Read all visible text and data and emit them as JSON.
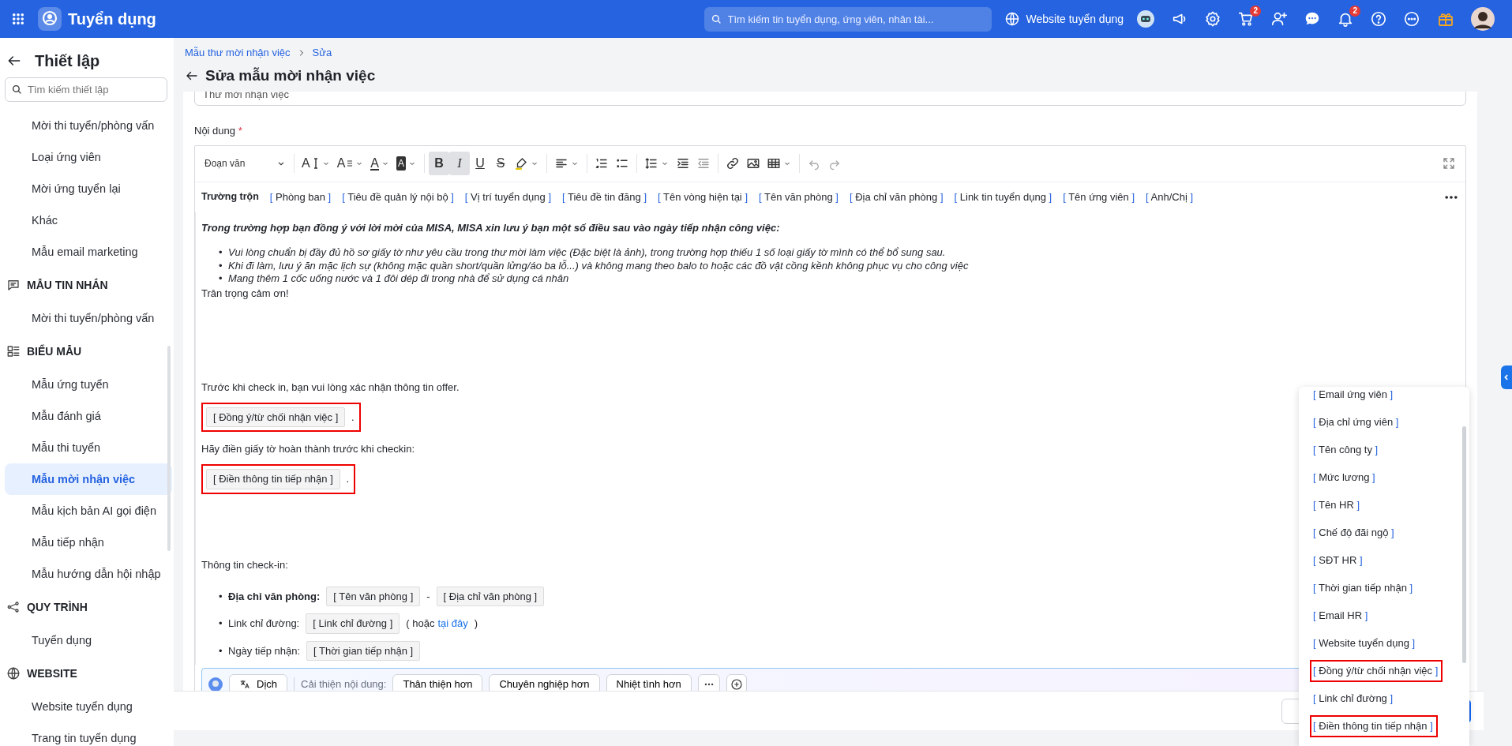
{
  "topbar": {
    "app_title": "Tuyển dụng",
    "search_placeholder": "Tìm kiếm tin tuyển dụng, ứng viên, nhân tài...",
    "website_link": "Website tuyển dụng",
    "cart_badge": "2",
    "bell_badge": "2"
  },
  "sidebar": {
    "title": "Thiết lập",
    "search_placeholder": "Tìm kiếm thiết lập",
    "groups": [
      {
        "items": [
          {
            "label": "Mời thi tuyển/phòng vấn",
            "selected": false
          },
          {
            "label": "Loại ứng viên",
            "selected": false
          },
          {
            "label": "Mời ứng tuyển lại",
            "selected": false
          },
          {
            "label": "Khác",
            "selected": false
          },
          {
            "label": "Mẫu email marketing",
            "selected": false
          }
        ]
      },
      {
        "heading": "MẪU TIN NHẮN",
        "kind": "message",
        "items": [
          {
            "label": "Mời thi tuyển/phòng vấn",
            "selected": false
          }
        ]
      },
      {
        "heading": "BIỂU MẪU",
        "kind": "form",
        "items": [
          {
            "label": "Mẫu ứng tuyển",
            "selected": false
          },
          {
            "label": "Mẫu đánh giá",
            "selected": false
          },
          {
            "label": "Mẫu thi tuyển",
            "selected": false
          },
          {
            "label": "Mẫu mời nhận việc",
            "selected": true
          },
          {
            "label": "Mẫu kịch bản AI gọi điện",
            "selected": false
          },
          {
            "label": "Mẫu tiếp nhận",
            "selected": false
          },
          {
            "label": "Mẫu hướng dẫn hội nhập",
            "selected": false
          }
        ]
      },
      {
        "heading": "QUY TRÌNH",
        "kind": "process",
        "items": [
          {
            "label": "Tuyển dụng",
            "selected": false
          }
        ]
      },
      {
        "heading": "WEBSITE",
        "kind": "web",
        "items": [
          {
            "label": "Website tuyển dụng",
            "selected": false
          },
          {
            "label": "Trang tin tuyển dụng",
            "selected": false
          }
        ]
      }
    ]
  },
  "breadcrumb": [
    "Mẫu thư mời nhận việc",
    "Sửa"
  ],
  "page_title": "Sửa mẫu mời nhận việc",
  "name_field": {
    "value": "Thư mời nhận việc"
  },
  "content_label": {
    "text": "Nội dung",
    "required_mark": "*"
  },
  "toolbar": {
    "block_format": "Đoạn văn",
    "text_tools": [
      {
        "kind": "size",
        "glyph": "A"
      },
      {
        "kind": "style",
        "glyph": "A"
      },
      {
        "kind": "color",
        "glyph": "A"
      },
      {
        "kind": "background",
        "glyph": "A"
      }
    ],
    "format_tools": [
      {
        "kind": "bold",
        "glyph": "B",
        "active": true
      },
      {
        "kind": "italic",
        "glyph": "I",
        "active": true
      },
      {
        "kind": "underline",
        "glyph": "U",
        "active": false
      },
      {
        "kind": "strike",
        "glyph": "S",
        "active": false
      }
    ]
  },
  "merge_fields": {
    "label": "Trường trộn",
    "fields": [
      "[ Phòng ban ]",
      "[ Tiêu đề quản lý nội bộ ]",
      "[ Vị trí tuyển dụng ]",
      "[ Tiêu đề tin đăng ]",
      "[ Tên vòng hiện tại ]",
      "[ Tên văn phòng ]",
      "[ Địa chỉ văn phòng ]",
      "[ Link tin tuyển dụng ]",
      "[ Tên ứng viên ]",
      "[ Anh/Chị ]"
    ]
  },
  "content": [
    {
      "kind": "lead",
      "text": "Trong trường hợp bạn đồng ý với lời mời của MISA, MISA xin lưu ý bạn một số điều sau vào ngày tiếp nhận công việc:"
    },
    {
      "kind": "italic_list",
      "items": [
        {
          "bullet": "•",
          "text": "Vui lòng chuẩn bị đầy đủ hồ sơ giấy tờ như yêu cầu trong thư mời làm việc (Đặc biệt là ảnh), trong trường hợp thiếu 1 số loại giấy tờ mình có thể bổ sung sau."
        },
        {
          "bullet": "•",
          "text": "Khi đi làm, lưu ý ăn mặc lịch sự (không mặc quần short/quần lửng/áo ba lỗ...) và không mang theo balo to hoặc các đồ vật cồng kềnh không phục vụ cho công việc"
        },
        {
          "bullet": "•",
          "text": "Mang thêm 1 cốc uống nước và 1 đôi dép đi trong nhà để sử dụng cá nhân"
        }
      ]
    },
    {
      "kind": "paragraph",
      "text": "Trân trọng cảm ơn!"
    },
    {
      "kind": "large_gap"
    },
    {
      "kind": "paragraph",
      "text": "Trước khi check in, bạn vui lòng xác nhận thông tin offer."
    },
    {
      "kind": "token_line",
      "token": "[ Đồng ý/từ chối nhận việc ]",
      "suffix": ".",
      "highlighted": true
    },
    {
      "kind": "paragraph",
      "text": "Hãy điền giấy tờ hoàn thành trước khi checkin:"
    },
    {
      "kind": "token_line",
      "token": "[ Điền thông tin tiếp nhận ]",
      "suffix": ".",
      "highlighted": true
    },
    {
      "kind": "medium_gap"
    },
    {
      "kind": "paragraph",
      "text": "Thông tin check-in:"
    },
    {
      "kind": "field_list",
      "items": [
        {
          "bullet": "•",
          "label": "Địa chỉ văn phòng:",
          "bold": true,
          "parts": [
            {
              "kind": "token",
              "text": "[ Tên văn phòng ]"
            },
            {
              "kind": "text",
              "text": "-"
            },
            {
              "kind": "token",
              "text": "[ Địa chỉ văn phòng ]"
            }
          ]
        },
        {
          "bullet": "•",
          "label": "Link chỉ đường:",
          "bold": false,
          "parts": [
            {
              "kind": "token",
              "text": "[ Link chỉ đường ]"
            },
            {
              "kind": "text",
              "text": "( hoặc"
            },
            {
              "kind": "link",
              "text": "tại đây"
            },
            {
              "kind": "text",
              "text": ")"
            }
          ]
        },
        {
          "bullet": "•",
          "label": "Ngày tiếp nhận:",
          "bold": false,
          "parts": [
            {
              "kind": "token",
              "text": "[ Thời gian tiếp nhận ]"
            }
          ]
        }
      ]
    }
  ],
  "ai_bar": {
    "translate": "Dịch",
    "improve_label": "Cải thiện nội dung:",
    "suggestions": [
      "Thân thiện hơn",
      "Chuyên nghiệp hơn",
      "Nhiệt tình hơn"
    ]
  },
  "field_menu": [
    {
      "label": "[ Email ứng viên ]",
      "highlighted": false
    },
    {
      "label": "[ Địa chỉ ứng viên ]",
      "highlighted": false
    },
    {
      "label": "[ Tên công ty ]",
      "highlighted": false
    },
    {
      "label": "[ Mức lương ]",
      "highlighted": false
    },
    {
      "label": "[ Tên HR ]",
      "highlighted": false
    },
    {
      "label": "[ Chế độ đãi ngộ ]",
      "highlighted": false
    },
    {
      "label": "[ SĐT HR ]",
      "highlighted": false
    },
    {
      "label": "[ Thời gian tiếp nhận ]",
      "highlighted": false
    },
    {
      "label": "[ Email HR ]",
      "highlighted": false
    },
    {
      "label": "[ Website tuyển dụng ]",
      "highlighted": false
    },
    {
      "label": "[ Đồng ý/từ chối nhận việc ]",
      "highlighted": true
    },
    {
      "label": "[ Link chỉ đường ]",
      "highlighted": false
    },
    {
      "label": "[ Điền thông tin tiếp nhận ]",
      "highlighted": true
    }
  ]
}
